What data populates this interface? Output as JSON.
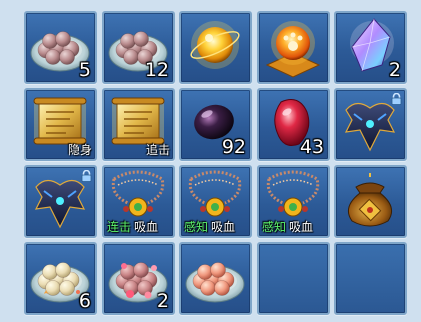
{
  "slots": [
    {
      "item": "tangyuan-plate-icon",
      "qty": "5",
      "tags": [],
      "locked": false
    },
    {
      "item": "tangyuan-plate-icon",
      "qty": "12",
      "tags": [],
      "locked": false
    },
    {
      "item": "golden-orb-icon",
      "qty": "",
      "tags": [],
      "locked": false
    },
    {
      "item": "paw-orb-icon",
      "qty": "",
      "tags": [],
      "locked": false
    },
    {
      "item": "purple-crystal-icon",
      "qty": "2",
      "tags": [],
      "locked": false
    },
    {
      "item": "scroll-icon",
      "qty": "",
      "tags": [
        {
          "text": "隐身",
          "color": "#ffffff"
        }
      ],
      "locked": false
    },
    {
      "item": "scroll-icon",
      "qty": "",
      "tags": [
        {
          "text": "追击",
          "color": "#ffffff"
        }
      ],
      "locked": false
    },
    {
      "item": "dark-gem-icon",
      "qty": "92",
      "tags": [],
      "locked": false
    },
    {
      "item": "red-gem-icon",
      "qty": "43",
      "tags": [],
      "locked": false
    },
    {
      "item": "armor-icon",
      "qty": "",
      "tags": [],
      "locked": true
    },
    {
      "item": "armor-icon",
      "qty": "",
      "tags": [],
      "locked": true
    },
    {
      "item": "necklace-icon",
      "qty": "",
      "tags": [
        {
          "text": "连击",
          "color": "#5cf36b"
        },
        {
          "text": "吸血",
          "color": "#ffffff"
        }
      ],
      "locked": false
    },
    {
      "item": "necklace-icon",
      "qty": "",
      "tags": [
        {
          "text": "感知",
          "color": "#5cf36b"
        },
        {
          "text": "吸血",
          "color": "#ffffff"
        }
      ],
      "locked": false
    },
    {
      "item": "necklace-icon",
      "qty": "",
      "tags": [
        {
          "text": "感知",
          "color": "#5cf36b"
        },
        {
          "text": "吸血",
          "color": "#ffffff"
        }
      ],
      "locked": false
    },
    {
      "item": "coin-pouch-icon",
      "qty": "",
      "tags": [],
      "locked": false
    },
    {
      "item": "tangyuan-cream-plate-icon",
      "qty": "6",
      "tags": [],
      "locked": false
    },
    {
      "item": "tangyuan-flower-plate-icon",
      "qty": "2",
      "tags": [],
      "locked": false
    },
    {
      "item": "tangyuan-peach-plate-icon",
      "qty": "",
      "tags": [],
      "locked": false
    },
    {
      "item": "",
      "qty": "",
      "tags": [],
      "locked": false
    },
    {
      "item": "",
      "qty": "",
      "tags": [],
      "locked": false
    }
  ]
}
